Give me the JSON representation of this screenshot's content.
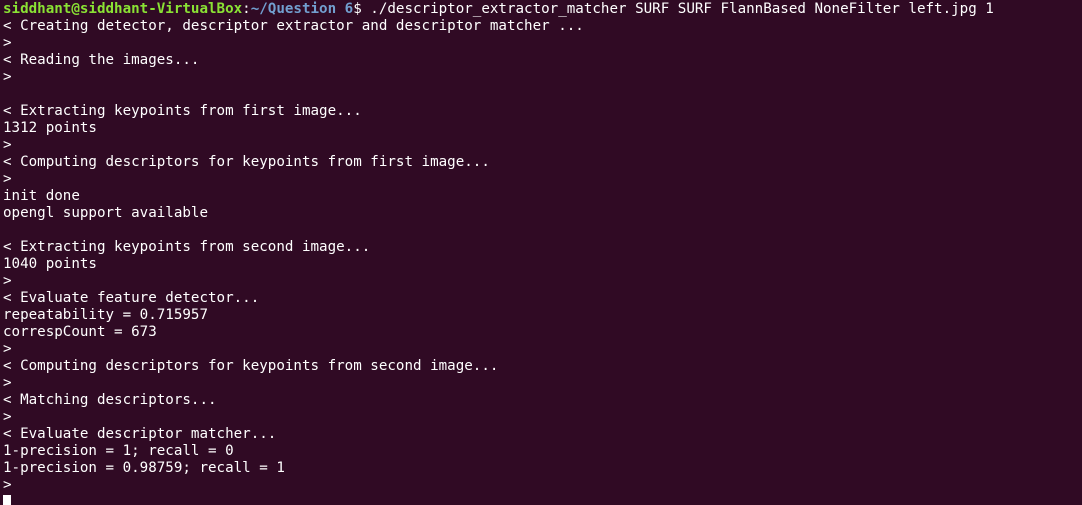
{
  "prompt": {
    "user_host": "siddhant@siddhant-VirtualBox",
    "separator": ":",
    "path": "~/Question 6",
    "symbol": "$",
    "command": " ./descriptor_extractor_matcher SURF SURF FlannBased NoneFilter left.jpg 1"
  },
  "output": [
    "< Creating detector, descriptor extractor and descriptor matcher ...",
    ">",
    "< Reading the images...",
    ">",
    "",
    "< Extracting keypoints from first image...",
    "1312 points",
    ">",
    "< Computing descriptors for keypoints from first image...",
    ">",
    "init done",
    "opengl support available",
    "",
    "< Extracting keypoints from second image...",
    "1040 points",
    ">",
    "< Evaluate feature detector...",
    "repeatability = 0.715957",
    "correspCount = 673",
    ">",
    "< Computing descriptors for keypoints from second image...",
    ">",
    "< Matching descriptors...",
    ">",
    "< Evaluate descriptor matcher...",
    "1-precision = 1; recall = 0",
    "1-precision = 0.98759; recall = 1",
    ">"
  ],
  "colors": {
    "background": "#300a24",
    "text": "#ffffff",
    "user_host": "#8ae234",
    "path": "#729fcf"
  }
}
